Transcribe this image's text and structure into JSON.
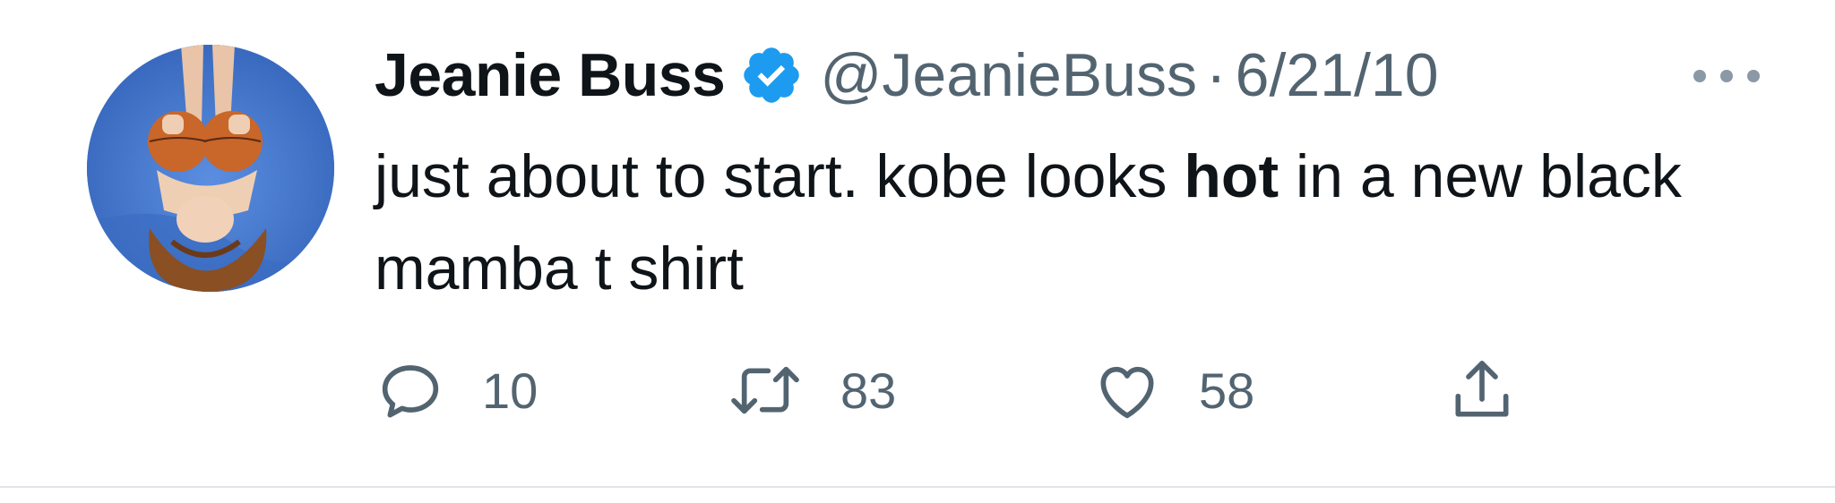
{
  "tweet": {
    "author": {
      "display_name": "Jeanie Buss",
      "handle": "@JeanieBuss",
      "verified_icon": "verified-badge-icon",
      "avatar": "profile-photo"
    },
    "separator": "·",
    "date": "6/21/10",
    "text": {
      "before_bold": "just about to start. kobe looks ",
      "bold": "hot",
      "after_bold": " in a new black mamba t shirt"
    },
    "actions": {
      "reply": {
        "icon": "reply-icon",
        "count": "10"
      },
      "retweet": {
        "icon": "retweet-icon",
        "count": "83"
      },
      "like": {
        "icon": "heart-icon",
        "count": "58"
      },
      "share": {
        "icon": "share-icon"
      }
    },
    "more_icon": "more-icon"
  },
  "colors": {
    "text_primary": "#0f1419",
    "text_secondary": "#536471",
    "verified": "#1d9bf0",
    "divider": "#e1e4e8"
  }
}
